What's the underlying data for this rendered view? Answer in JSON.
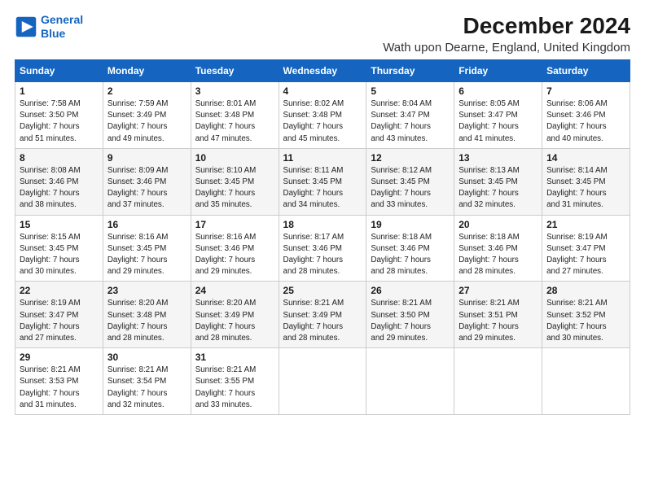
{
  "logo": {
    "line1": "General",
    "line2": "Blue",
    "icon": "▶"
  },
  "title": "December 2024",
  "subtitle": "Wath upon Dearne, England, United Kingdom",
  "days_header": [
    "Sunday",
    "Monday",
    "Tuesday",
    "Wednesday",
    "Thursday",
    "Friday",
    "Saturday"
  ],
  "weeks": [
    [
      {
        "day": "1",
        "info": "Sunrise: 7:58 AM\nSunset: 3:50 PM\nDaylight: 7 hours\nand 51 minutes."
      },
      {
        "day": "2",
        "info": "Sunrise: 7:59 AM\nSunset: 3:49 PM\nDaylight: 7 hours\nand 49 minutes."
      },
      {
        "day": "3",
        "info": "Sunrise: 8:01 AM\nSunset: 3:48 PM\nDaylight: 7 hours\nand 47 minutes."
      },
      {
        "day": "4",
        "info": "Sunrise: 8:02 AM\nSunset: 3:48 PM\nDaylight: 7 hours\nand 45 minutes."
      },
      {
        "day": "5",
        "info": "Sunrise: 8:04 AM\nSunset: 3:47 PM\nDaylight: 7 hours\nand 43 minutes."
      },
      {
        "day": "6",
        "info": "Sunrise: 8:05 AM\nSunset: 3:47 PM\nDaylight: 7 hours\nand 41 minutes."
      },
      {
        "day": "7",
        "info": "Sunrise: 8:06 AM\nSunset: 3:46 PM\nDaylight: 7 hours\nand 40 minutes."
      }
    ],
    [
      {
        "day": "8",
        "info": "Sunrise: 8:08 AM\nSunset: 3:46 PM\nDaylight: 7 hours\nand 38 minutes."
      },
      {
        "day": "9",
        "info": "Sunrise: 8:09 AM\nSunset: 3:46 PM\nDaylight: 7 hours\nand 37 minutes."
      },
      {
        "day": "10",
        "info": "Sunrise: 8:10 AM\nSunset: 3:45 PM\nDaylight: 7 hours\nand 35 minutes."
      },
      {
        "day": "11",
        "info": "Sunrise: 8:11 AM\nSunset: 3:45 PM\nDaylight: 7 hours\nand 34 minutes."
      },
      {
        "day": "12",
        "info": "Sunrise: 8:12 AM\nSunset: 3:45 PM\nDaylight: 7 hours\nand 33 minutes."
      },
      {
        "day": "13",
        "info": "Sunrise: 8:13 AM\nSunset: 3:45 PM\nDaylight: 7 hours\nand 32 minutes."
      },
      {
        "day": "14",
        "info": "Sunrise: 8:14 AM\nSunset: 3:45 PM\nDaylight: 7 hours\nand 31 minutes."
      }
    ],
    [
      {
        "day": "15",
        "info": "Sunrise: 8:15 AM\nSunset: 3:45 PM\nDaylight: 7 hours\nand 30 minutes."
      },
      {
        "day": "16",
        "info": "Sunrise: 8:16 AM\nSunset: 3:45 PM\nDaylight: 7 hours\nand 29 minutes."
      },
      {
        "day": "17",
        "info": "Sunrise: 8:16 AM\nSunset: 3:46 PM\nDaylight: 7 hours\nand 29 minutes."
      },
      {
        "day": "18",
        "info": "Sunrise: 8:17 AM\nSunset: 3:46 PM\nDaylight: 7 hours\nand 28 minutes."
      },
      {
        "day": "19",
        "info": "Sunrise: 8:18 AM\nSunset: 3:46 PM\nDaylight: 7 hours\nand 28 minutes."
      },
      {
        "day": "20",
        "info": "Sunrise: 8:18 AM\nSunset: 3:46 PM\nDaylight: 7 hours\nand 28 minutes."
      },
      {
        "day": "21",
        "info": "Sunrise: 8:19 AM\nSunset: 3:47 PM\nDaylight: 7 hours\nand 27 minutes."
      }
    ],
    [
      {
        "day": "22",
        "info": "Sunrise: 8:19 AM\nSunset: 3:47 PM\nDaylight: 7 hours\nand 27 minutes."
      },
      {
        "day": "23",
        "info": "Sunrise: 8:20 AM\nSunset: 3:48 PM\nDaylight: 7 hours\nand 28 minutes."
      },
      {
        "day": "24",
        "info": "Sunrise: 8:20 AM\nSunset: 3:49 PM\nDaylight: 7 hours\nand 28 minutes."
      },
      {
        "day": "25",
        "info": "Sunrise: 8:21 AM\nSunset: 3:49 PM\nDaylight: 7 hours\nand 28 minutes."
      },
      {
        "day": "26",
        "info": "Sunrise: 8:21 AM\nSunset: 3:50 PM\nDaylight: 7 hours\nand 29 minutes."
      },
      {
        "day": "27",
        "info": "Sunrise: 8:21 AM\nSunset: 3:51 PM\nDaylight: 7 hours\nand 29 minutes."
      },
      {
        "day": "28",
        "info": "Sunrise: 8:21 AM\nSunset: 3:52 PM\nDaylight: 7 hours\nand 30 minutes."
      }
    ],
    [
      {
        "day": "29",
        "info": "Sunrise: 8:21 AM\nSunset: 3:53 PM\nDaylight: 7 hours\nand 31 minutes."
      },
      {
        "day": "30",
        "info": "Sunrise: 8:21 AM\nSunset: 3:54 PM\nDaylight: 7 hours\nand 32 minutes."
      },
      {
        "day": "31",
        "info": "Sunrise: 8:21 AM\nSunset: 3:55 PM\nDaylight: 7 hours\nand 33 minutes."
      },
      {
        "day": "",
        "info": ""
      },
      {
        "day": "",
        "info": ""
      },
      {
        "day": "",
        "info": ""
      },
      {
        "day": "",
        "info": ""
      }
    ]
  ]
}
